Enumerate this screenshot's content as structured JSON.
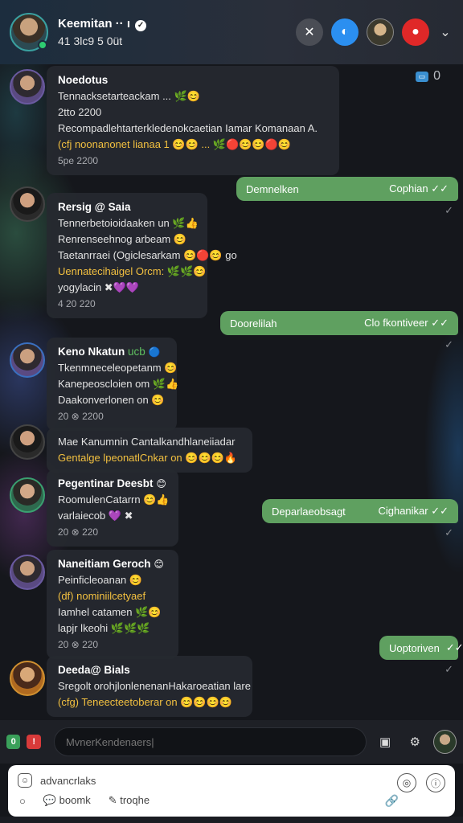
{
  "header": {
    "name": "Keemitan ·· ı",
    "status": "41 3lc9 5 0üt",
    "verified_icon": "check-badge-icon",
    "actions": [
      "close-icon",
      "chat-bubble-icon",
      "contact-avatar",
      "record-icon",
      "chevron-down-icon"
    ]
  },
  "corner": {
    "badge": "▭",
    "count": "0"
  },
  "messages": [
    {
      "type": "in",
      "name": "Noedotus",
      "lines": [
        "Tennacksetarteackam ... 🌿😊",
        "2tto 2200",
        "Recompadlehtarterkledenokcaetian Iamar Komanaan A.",
        "(cfj noonanonet lianaa 1 😊😊 ... 🌿🔴😊😊🔴😊"
      ],
      "gold_line": 3,
      "time": "5pe 2200"
    },
    {
      "type": "out",
      "text": "Demnelken",
      "meta": "Cophian ✓✓"
    },
    {
      "type": "in",
      "name": "Rersig @ Saia",
      "lines": [
        "Tennerbetoioidaaken un 🌿👍",
        "Renrenseehnog arbeam 😊",
        "Taetanrraei (Ogiclesarkam 😊🔴😊 go",
        "Uennatecihaigel Orcm: 🌿🌿😊",
        "yogylacin ✖💜💜"
      ],
      "gold_line": 3,
      "time": "4 20 220"
    },
    {
      "type": "out",
      "text": "Doorelilah",
      "meta": "Clo fkontiveer ✓✓"
    },
    {
      "type": "in",
      "name": "Keno Nkatun",
      "lines": [
        "Tkenmneceleopetanm 😊",
        "Kanepeoscloien om 🌿👍",
        "Daakonverlonen on 😊"
      ],
      "gold_line": -1,
      "time": "20 ⊗ 2200"
    },
    {
      "type": "in",
      "name": "",
      "lines": [
        "Mae Kanumnin Cantalkandhlaneiiadar",
        "Gentalge lpeonatlCnkar on 😊😊😊🔥"
      ],
      "gold_line": 1,
      "time": ""
    },
    {
      "type": "in",
      "name": "Pegentinar Deesbt",
      "lines": [
        "RoomulenCatarrn 😊👍",
        "varlaiecob 💜 ✖"
      ],
      "gold_line": -1,
      "time": "20 ⊗ 220"
    },
    {
      "type": "out",
      "text": "Deparlaeobsagt",
      "meta": "Cighanikar ✓✓"
    },
    {
      "type": "in",
      "name": "Naneitiam Geroch",
      "lines": [
        "Peinficleoanan 😊",
        "(df) nominiilcetyaef",
        "Iamhel catamen 🌿😊",
        "lapjr lkeohi 🌿🌿🌿"
      ],
      "gold_line": 1,
      "time": "20 ⊗ 220"
    },
    {
      "type": "out",
      "text": "Uoptoriven",
      "meta": "✓✓"
    },
    {
      "type": "in",
      "name": "Deeda@ Bials",
      "lines": [
        "Sregolt orohjlonlenenanHakaroeatian lare",
        "(cfg) Teneecteetoberar on 😊😊😊😊"
      ],
      "gold_line": 1,
      "time": ""
    }
  ],
  "composer": {
    "left_icons": [
      "0",
      "!"
    ],
    "placeholder": "MvnerKendenaers|",
    "right_icons": [
      "sticker-icon",
      "settings-icon"
    ]
  },
  "sheet": {
    "top_label": "advancrlaks",
    "row2": [
      "boomk",
      "troqhe"
    ],
    "dot": "○"
  }
}
